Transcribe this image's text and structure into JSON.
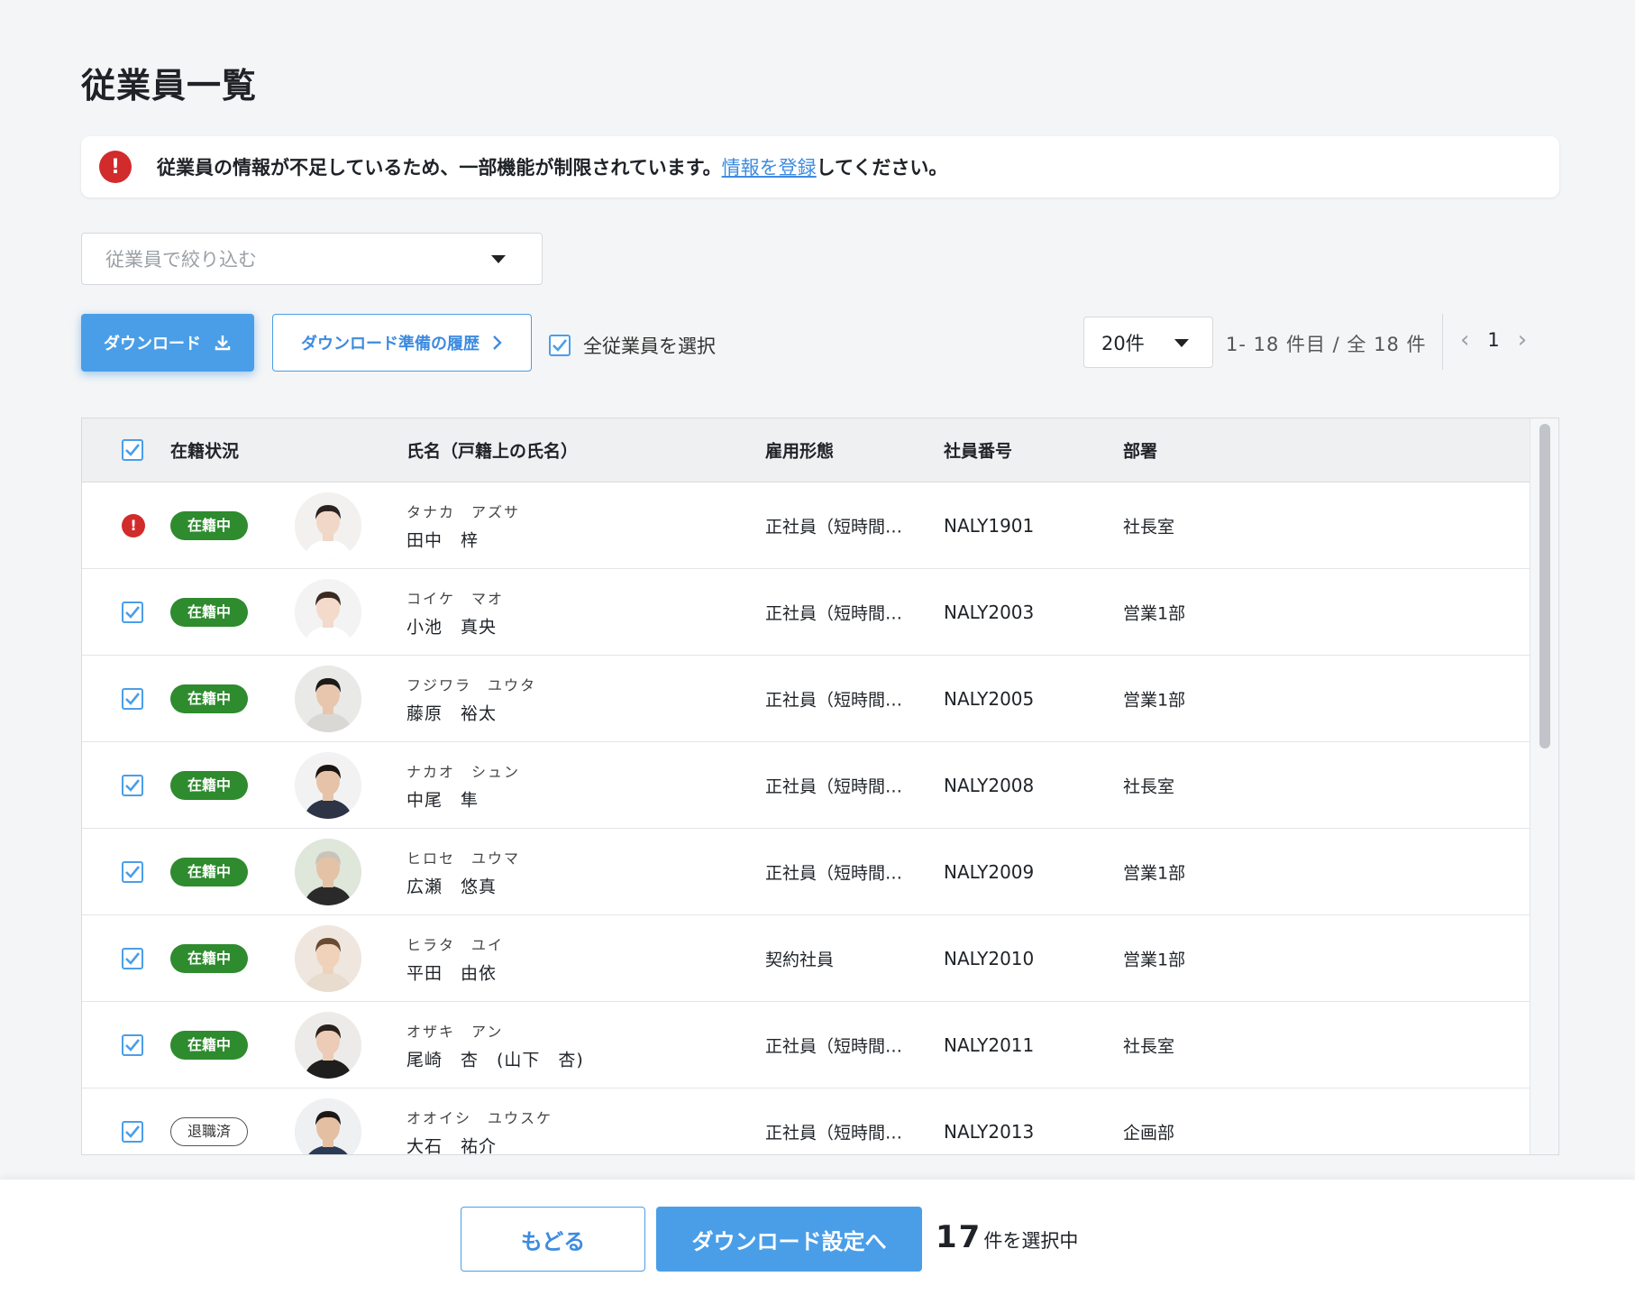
{
  "page": {
    "title": "従業員一覧"
  },
  "alert": {
    "text_before": "従業員の情報が不足しているため、一部機能が制限されています。",
    "link_text": "情報を登録",
    "text_after": "してください。",
    "icon": "exclamation-icon"
  },
  "filter": {
    "placeholder": "従業員で絞り込む"
  },
  "toolbar": {
    "download_label": "ダウンロード",
    "history_label": "ダウンロード準備の履歴",
    "select_all_label": "全従業員を選択",
    "select_all_checked": true
  },
  "pagination": {
    "per_page": "20件",
    "range": "1- 18 件目 /  全 18 件",
    "current_page": "1"
  },
  "table": {
    "headers": {
      "status": "在籍状況",
      "name": "氏名（戸籍上の氏名）",
      "employment_type": "雇用形態",
      "employee_id": "社員番号",
      "department": "部署"
    },
    "rows": [
      {
        "status": "在籍中",
        "status_kind": "active",
        "checkbox": "warning",
        "kana": "タナカ　アズサ",
        "name": "田中　梓",
        "type": "正社員（短時間…",
        "id": "NALY1901",
        "dept": "社長室",
        "avatar": {
          "bg": "#f3f1ef",
          "hair": "#2b2220",
          "skin": "#f1d7c7",
          "shirt": "#ffffff"
        }
      },
      {
        "status": "在籍中",
        "status_kind": "active",
        "checkbox": "checked",
        "kana": "コイケ　マオ",
        "name": "小池　真央",
        "type": "正社員（短時間…",
        "id": "NALY2003",
        "dept": "営業1部",
        "avatar": {
          "bg": "#f3f3f3",
          "hair": "#3a2a22",
          "skin": "#f3dacb",
          "shirt": "#ffffff"
        }
      },
      {
        "status": "在籍中",
        "status_kind": "active",
        "checkbox": "checked",
        "kana": "フジワラ　ユウタ",
        "name": "藤原　裕太",
        "type": "正社員（短時間…",
        "id": "NALY2005",
        "dept": "営業1部",
        "avatar": {
          "bg": "#e9e9e7",
          "hair": "#1d1a18",
          "skin": "#e8c6ad",
          "shirt": "#d9d8d4"
        }
      },
      {
        "status": "在籍中",
        "status_kind": "active",
        "checkbox": "checked",
        "kana": "ナカオ　シュン",
        "name": "中尾　隼",
        "type": "正社員（短時間…",
        "id": "NALY2008",
        "dept": "社長室",
        "avatar": {
          "bg": "#f2f2f2",
          "hair": "#1a1512",
          "skin": "#e6c3a8",
          "shirt": "#2c3446"
        }
      },
      {
        "status": "在籍中",
        "status_kind": "active",
        "checkbox": "checked",
        "kana": "ヒロセ　ユウマ",
        "name": "広瀬　悠真",
        "type": "正社員（短時間…",
        "id": "NALY2009",
        "dept": "営業1部",
        "avatar": {
          "bg": "#dfe6da",
          "hair": "#c9c3b8",
          "skin": "#e4c2a6",
          "shirt": "#2a2a2a"
        }
      },
      {
        "status": "在籍中",
        "status_kind": "active",
        "checkbox": "checked",
        "kana": "ヒラタ　ユイ",
        "name": "平田　由依",
        "type": "契約社員",
        "id": "NALY2010",
        "dept": "営業1部",
        "avatar": {
          "bg": "#efe7df",
          "hair": "#6b4a33",
          "skin": "#f0d2bb",
          "shirt": "#e8dccf"
        }
      },
      {
        "status": "在籍中",
        "status_kind": "active",
        "checkbox": "checked",
        "kana": "オザキ　アン",
        "name": "尾崎　杏　(山下　杏)",
        "type": "正社員（短時間…",
        "id": "NALY2011",
        "dept": "社長室",
        "avatar": {
          "bg": "#ecebe9",
          "hair": "#2a211c",
          "skin": "#ecccb6",
          "shirt": "#1e1e1e"
        }
      },
      {
        "status": "退職済",
        "status_kind": "retired",
        "checkbox": "checked",
        "kana": "オオイシ　ユウスケ",
        "name": "大石　祐介",
        "type": "正社員（短時間…",
        "id": "NALY2013",
        "dept": "企画部",
        "avatar": {
          "bg": "#eef0f2",
          "hair": "#1d1815",
          "skin": "#e4bfa2",
          "shirt": "#2d3a55"
        }
      }
    ]
  },
  "footer": {
    "back_label": "もどる",
    "next_label": "ダウンロード設定へ",
    "selected_count": "17",
    "selected_suffix": "件を選択中"
  },
  "colors": {
    "primary": "#4a9ee8",
    "active_badge": "#2e8b2e",
    "error": "#d22b2b"
  }
}
